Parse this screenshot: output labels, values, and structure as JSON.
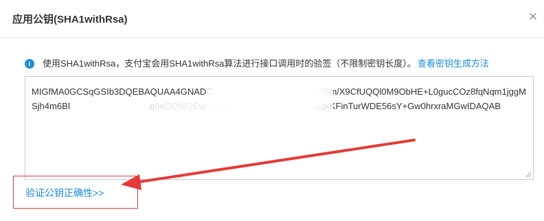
{
  "dialog": {
    "title": "应用公钥(SHA1withRsa)",
    "close_symbol": "✕"
  },
  "info": {
    "icon_symbol": "i",
    "text": "使用SHA1withRsa，支付宝会用SHA1withRsa算法进行接口调用时的验签（不限制密钥长度）。",
    "link": "查看密钥生成方法"
  },
  "public_key": {
    "value": "MIGfMA0GCSqGSIb3DQEBAQUAA4GNADC                               W1hBRil6m/X9CfUQQl0M9ObHE+L0gucCOz8fqNqm1jggMSjh4m6BI                                q6eOQMQEwiGsaObBf00qDH3US+js6u0xgkKFinTurWDE56sY+Gw0hrxraMGwIDAQAB"
  },
  "verify": {
    "link": "验证公钥正确性>>"
  },
  "colors": {
    "accent": "#1a8ad8",
    "annotation_red": "#e43a3a",
    "info_icon": "#1e8fd8"
  },
  "icons": {
    "close": "close-icon",
    "info": "info-icon",
    "resize": "resize-handle-icon",
    "arrow": "arrow-annotation-icon"
  }
}
